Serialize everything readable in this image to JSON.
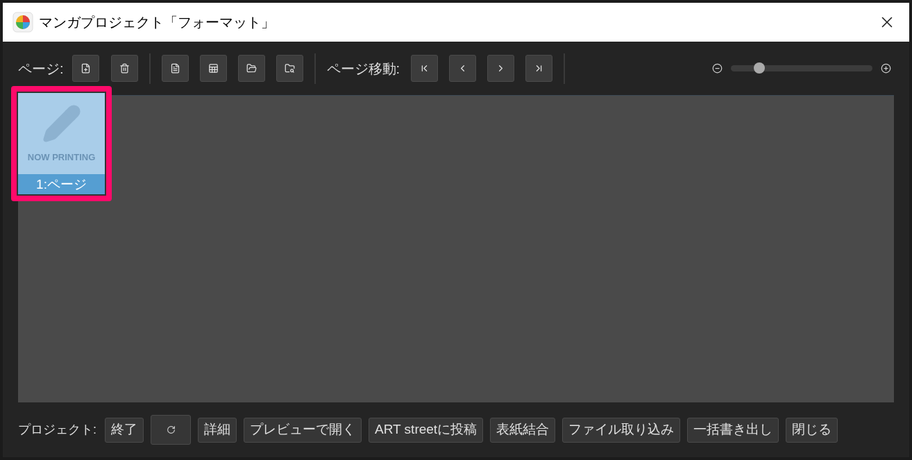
{
  "window": {
    "title": "マンガプロジェクト「フォーマット」"
  },
  "toolbar": {
    "page_label": "ページ:",
    "nav_label": "ページ移動:",
    "zoom": {
      "level": 0.2
    }
  },
  "pages": [
    {
      "placeholder": "NOW PRINTING",
      "label": "1:ページ",
      "selected": true
    }
  ],
  "footer": {
    "label": "プロジェクト:",
    "buttons": [
      {
        "kind": "text",
        "label": "終了"
      },
      {
        "kind": "refresh"
      },
      {
        "kind": "text",
        "label": "詳細"
      },
      {
        "kind": "text",
        "label": "プレビューで開く"
      },
      {
        "kind": "text",
        "label": "ART streetに投稿"
      },
      {
        "kind": "text",
        "label": "表紙結合"
      },
      {
        "kind": "text",
        "label": "ファイル取り込み"
      },
      {
        "kind": "text",
        "label": "一括書き出し"
      },
      {
        "kind": "text",
        "label": "閉じる"
      }
    ]
  }
}
